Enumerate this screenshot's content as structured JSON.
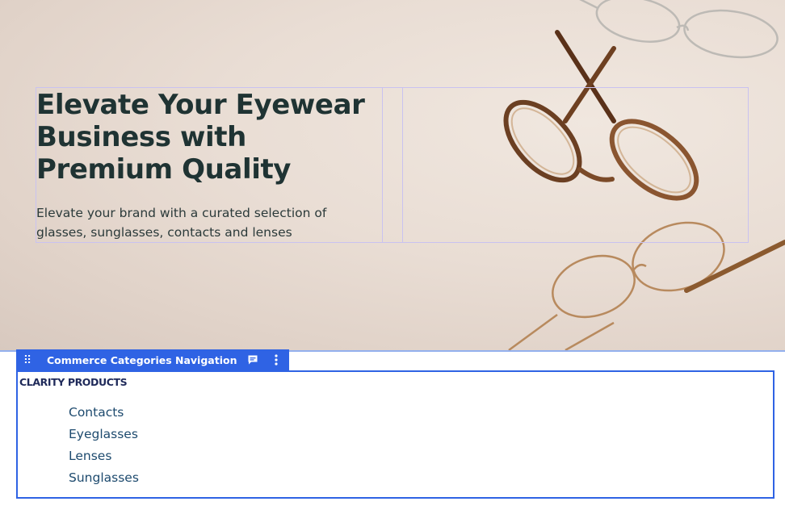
{
  "hero": {
    "title": "Elevate Your Eyewear Business with Premium Quality",
    "subtitle": "Elevate your brand with a curated selection of glasses, sunglasses, contacts and lenses",
    "image_icon": "eyeglasses-photo"
  },
  "toolbar": {
    "label": "Commerce Categories Navigation",
    "drag_icon": "drag-handle-icon",
    "comment_icon": "comment-icon",
    "more_icon": "more-vertical-icon"
  },
  "categories": {
    "heading": "CLARITY PRODUCTS",
    "items": [
      {
        "label": "Contacts"
      },
      {
        "label": "Eyeglasses"
      },
      {
        "label": "Lenses"
      },
      {
        "label": "Sunglasses"
      }
    ]
  },
  "colors": {
    "accent": "#2f63e4",
    "title": "#1f3333",
    "link": "#1d4a6e"
  }
}
